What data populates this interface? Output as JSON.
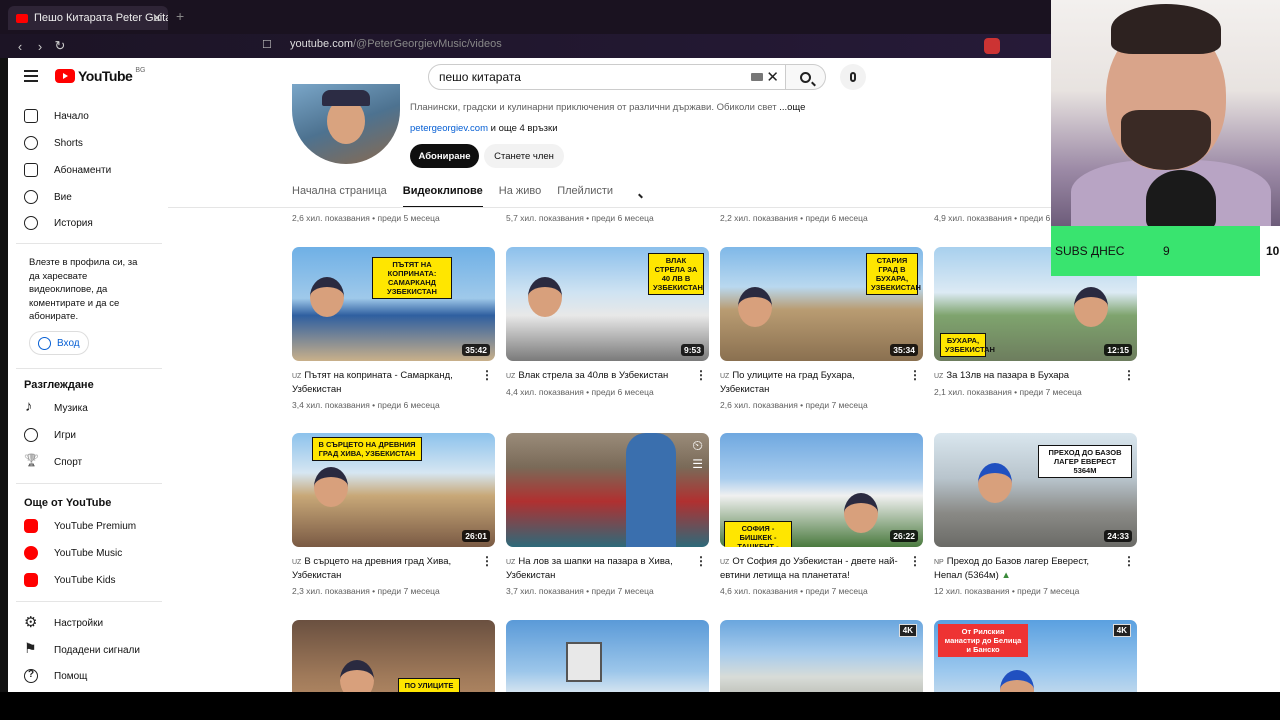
{
  "browser": {
    "tab_title": "Пешо Китарата Peter Guitar Tra",
    "url_domain": "youtube.com",
    "url_path": "/@PeterGeorgievMusic/videos"
  },
  "header": {
    "logo_text": "YouTube",
    "region": "BG",
    "search_value": "пешо китарата"
  },
  "sidebar": {
    "main": [
      {
        "label": "Начало",
        "icon": "home-icon"
      },
      {
        "label": "Shorts",
        "icon": "shorts-icon"
      },
      {
        "label": "Абонаменти",
        "icon": "subscriptions-icon"
      },
      {
        "label": "Вие",
        "icon": "you-icon"
      },
      {
        "label": "История",
        "icon": "history-icon"
      }
    ],
    "login_text": "Влезте в профила си, за да харесвате видеоклипове, да коментирате и да се абонирате.",
    "login_button": "Вход",
    "explore_heading": "Разглеждане",
    "explore": [
      {
        "label": "Музика",
        "icon": "music-icon"
      },
      {
        "label": "Игри",
        "icon": "gaming-icon"
      },
      {
        "label": "Спорт",
        "icon": "sports-icon"
      }
    ],
    "more_heading": "Още от YouTube",
    "more": [
      {
        "label": "YouTube Premium",
        "icon": "youtube-premium-icon"
      },
      {
        "label": "YouTube Music",
        "icon": "youtube-music-icon"
      },
      {
        "label": "YouTube Kids",
        "icon": "youtube-kids-icon"
      }
    ],
    "settings": [
      {
        "label": "Настройки",
        "icon": "gear-icon"
      },
      {
        "label": "Подадени сигнали",
        "icon": "flag-icon"
      },
      {
        "label": "Помощ",
        "icon": "help-icon"
      }
    ]
  },
  "channel": {
    "description": "Планински, градски и кулинарни приключения от различни държави. Обиколи свет",
    "more": "...още",
    "link": "petergeorgiev.com",
    "more_links": "и още 4 връзки",
    "subscribe": "Абониране",
    "member": "Станете член",
    "tabs": [
      "Начална страница",
      "Видеоклипове",
      "На живо",
      "Плейлисти"
    ],
    "active_tab": "Видеоклипове"
  },
  "top_row_meta": [
    "2,6 хил. показвания • преди 5 месеца",
    "5,7 хил. показвания • преди 6 месеца",
    "2,2 хил. показвания • преди 6 месеца",
    "4,9 хил. показвания • преди 6 месеца"
  ],
  "videos": [
    {
      "lang": "UZ",
      "title": "Пътят на коприната - Самарканд, Узбекистан",
      "meta": "3,4 хил. показвания • преди 6 месеца",
      "duration": "35:42",
      "caption": "ПЪТЯТ НА КОПРИНАТА: САМАРКАНД УЗБЕКИСТАН"
    },
    {
      "lang": "UZ",
      "title": "Влак стрела за 40лв в Узбекистан",
      "meta": "4,4 хил. показвания • преди 6 месеца",
      "duration": "9:53",
      "caption": "ВЛАК СТРЕЛА ЗА 40 ЛВ В УЗБЕКИСТАН"
    },
    {
      "lang": "UZ",
      "title": "По улиците на град Бухара, Узбекистан",
      "meta": "2,6 хил. показвания • преди 7 месеца",
      "duration": "35:34",
      "caption": "СТАРИЯ ГРАД В БУХАРА, УЗБЕКИСТАН"
    },
    {
      "lang": "UZ",
      "title": "За 13лв на пазара в Бухара",
      "meta": "2,1 хил. показвания • преди 7 месеца",
      "duration": "12:15",
      "caption": "БУХАРА, УЗБЕКИСТАН"
    },
    {
      "lang": "UZ",
      "title": "В сърцето на древния град Хива, Узбекистан",
      "meta": "2,3 хил. показвания • преди 7 месеца",
      "duration": "26:01",
      "caption": "В СЪРЦЕТО НА ДРЕВНИЯ ГРАД ХИВА, УЗБЕКИСТАН"
    },
    {
      "lang": "UZ",
      "title": "На лов за шапки на пазара в Хива, Узбекистан",
      "meta": "3,7 хил. показвания • преди 7 месеца",
      "duration": "",
      "caption": ""
    },
    {
      "lang": "UZ",
      "title": "От София до Узбекистан - двете най-евтини летища на планетата!",
      "meta": "4,6 хил. показвания • преди 7 месеца",
      "duration": "26:22",
      "caption": "СОФИЯ - БИШКЕК - ТАШКЕНТ - ХИВА"
    },
    {
      "lang": "NP",
      "title": "Преход до Базов лагер Еверест, Непал (5364м)",
      "meta": "12 хил. показвания • преди 7 месеца",
      "duration": "24:33",
      "caption": "ПРЕХОД ДО БАЗОВ ЛАГЕР ЕВЕРЕСТ 5364М"
    }
  ],
  "bottom_row": [
    {
      "caption": "ПО УЛИЦИТЕ НА",
      "badge": ""
    },
    {
      "caption": "",
      "badge": ""
    },
    {
      "caption": "",
      "badge": "4K"
    },
    {
      "caption": "От Рилския манастир до Белица и Банско",
      "badge": "4K"
    }
  ],
  "overlay": {
    "subs_label": "SUBS ДНЕС",
    "subs_value": "9",
    "subs_goal": "10"
  }
}
